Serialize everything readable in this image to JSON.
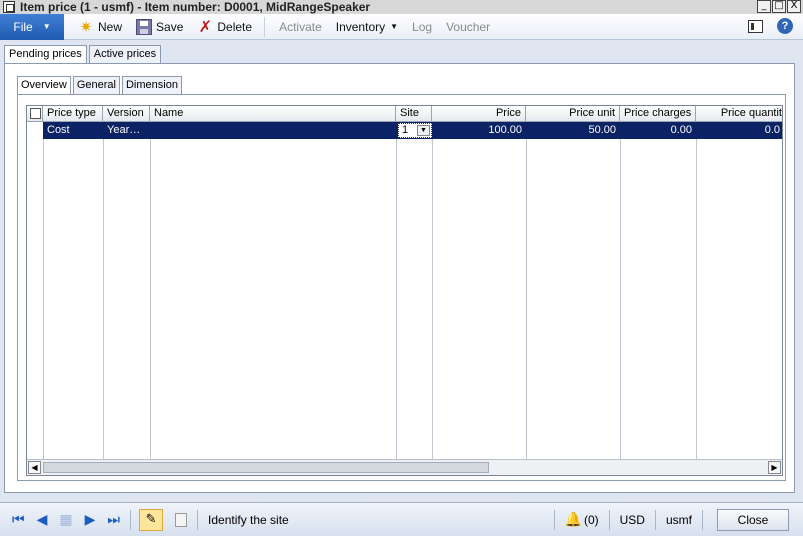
{
  "window": {
    "title": "Item price (1 - usmf) - Item number: D0001, MidRangeSpeaker",
    "minimize": "_",
    "maximize": "□",
    "close": "X"
  },
  "ribbon": {
    "file_label": "File",
    "new_label": "New",
    "save_label": "Save",
    "delete_label": "Delete",
    "activate_label": "Activate",
    "inventory_label": "Inventory",
    "log_label": "Log",
    "voucher_label": "Voucher",
    "help_label": "?"
  },
  "outer_tabs": [
    "Pending prices",
    "Active prices"
  ],
  "inner_tabs": [
    "Overview",
    "General",
    "Dimension"
  ],
  "grid": {
    "columns": [
      "Price type",
      "Version",
      "Name",
      "Site",
      "Price",
      "Price unit",
      "Price charges",
      "Price quantit"
    ],
    "rows": [
      {
        "price_type": "Cost",
        "version": "Year…",
        "name": "",
        "site": "1",
        "price": "100.00",
        "price_unit": "50.00",
        "price_charges": "0.00",
        "price_quantity": "0.0"
      }
    ]
  },
  "statusbar": {
    "status_text": "Identify the site",
    "notifications": "(0)",
    "currency": "USD",
    "company": "usmf",
    "close_label": "Close"
  },
  "icons": {
    "new": "sun-icon",
    "save": "floppy-disk-icon",
    "delete": "red-x-icon",
    "edit": "pencil-icon",
    "notifications": "bell-icon"
  }
}
